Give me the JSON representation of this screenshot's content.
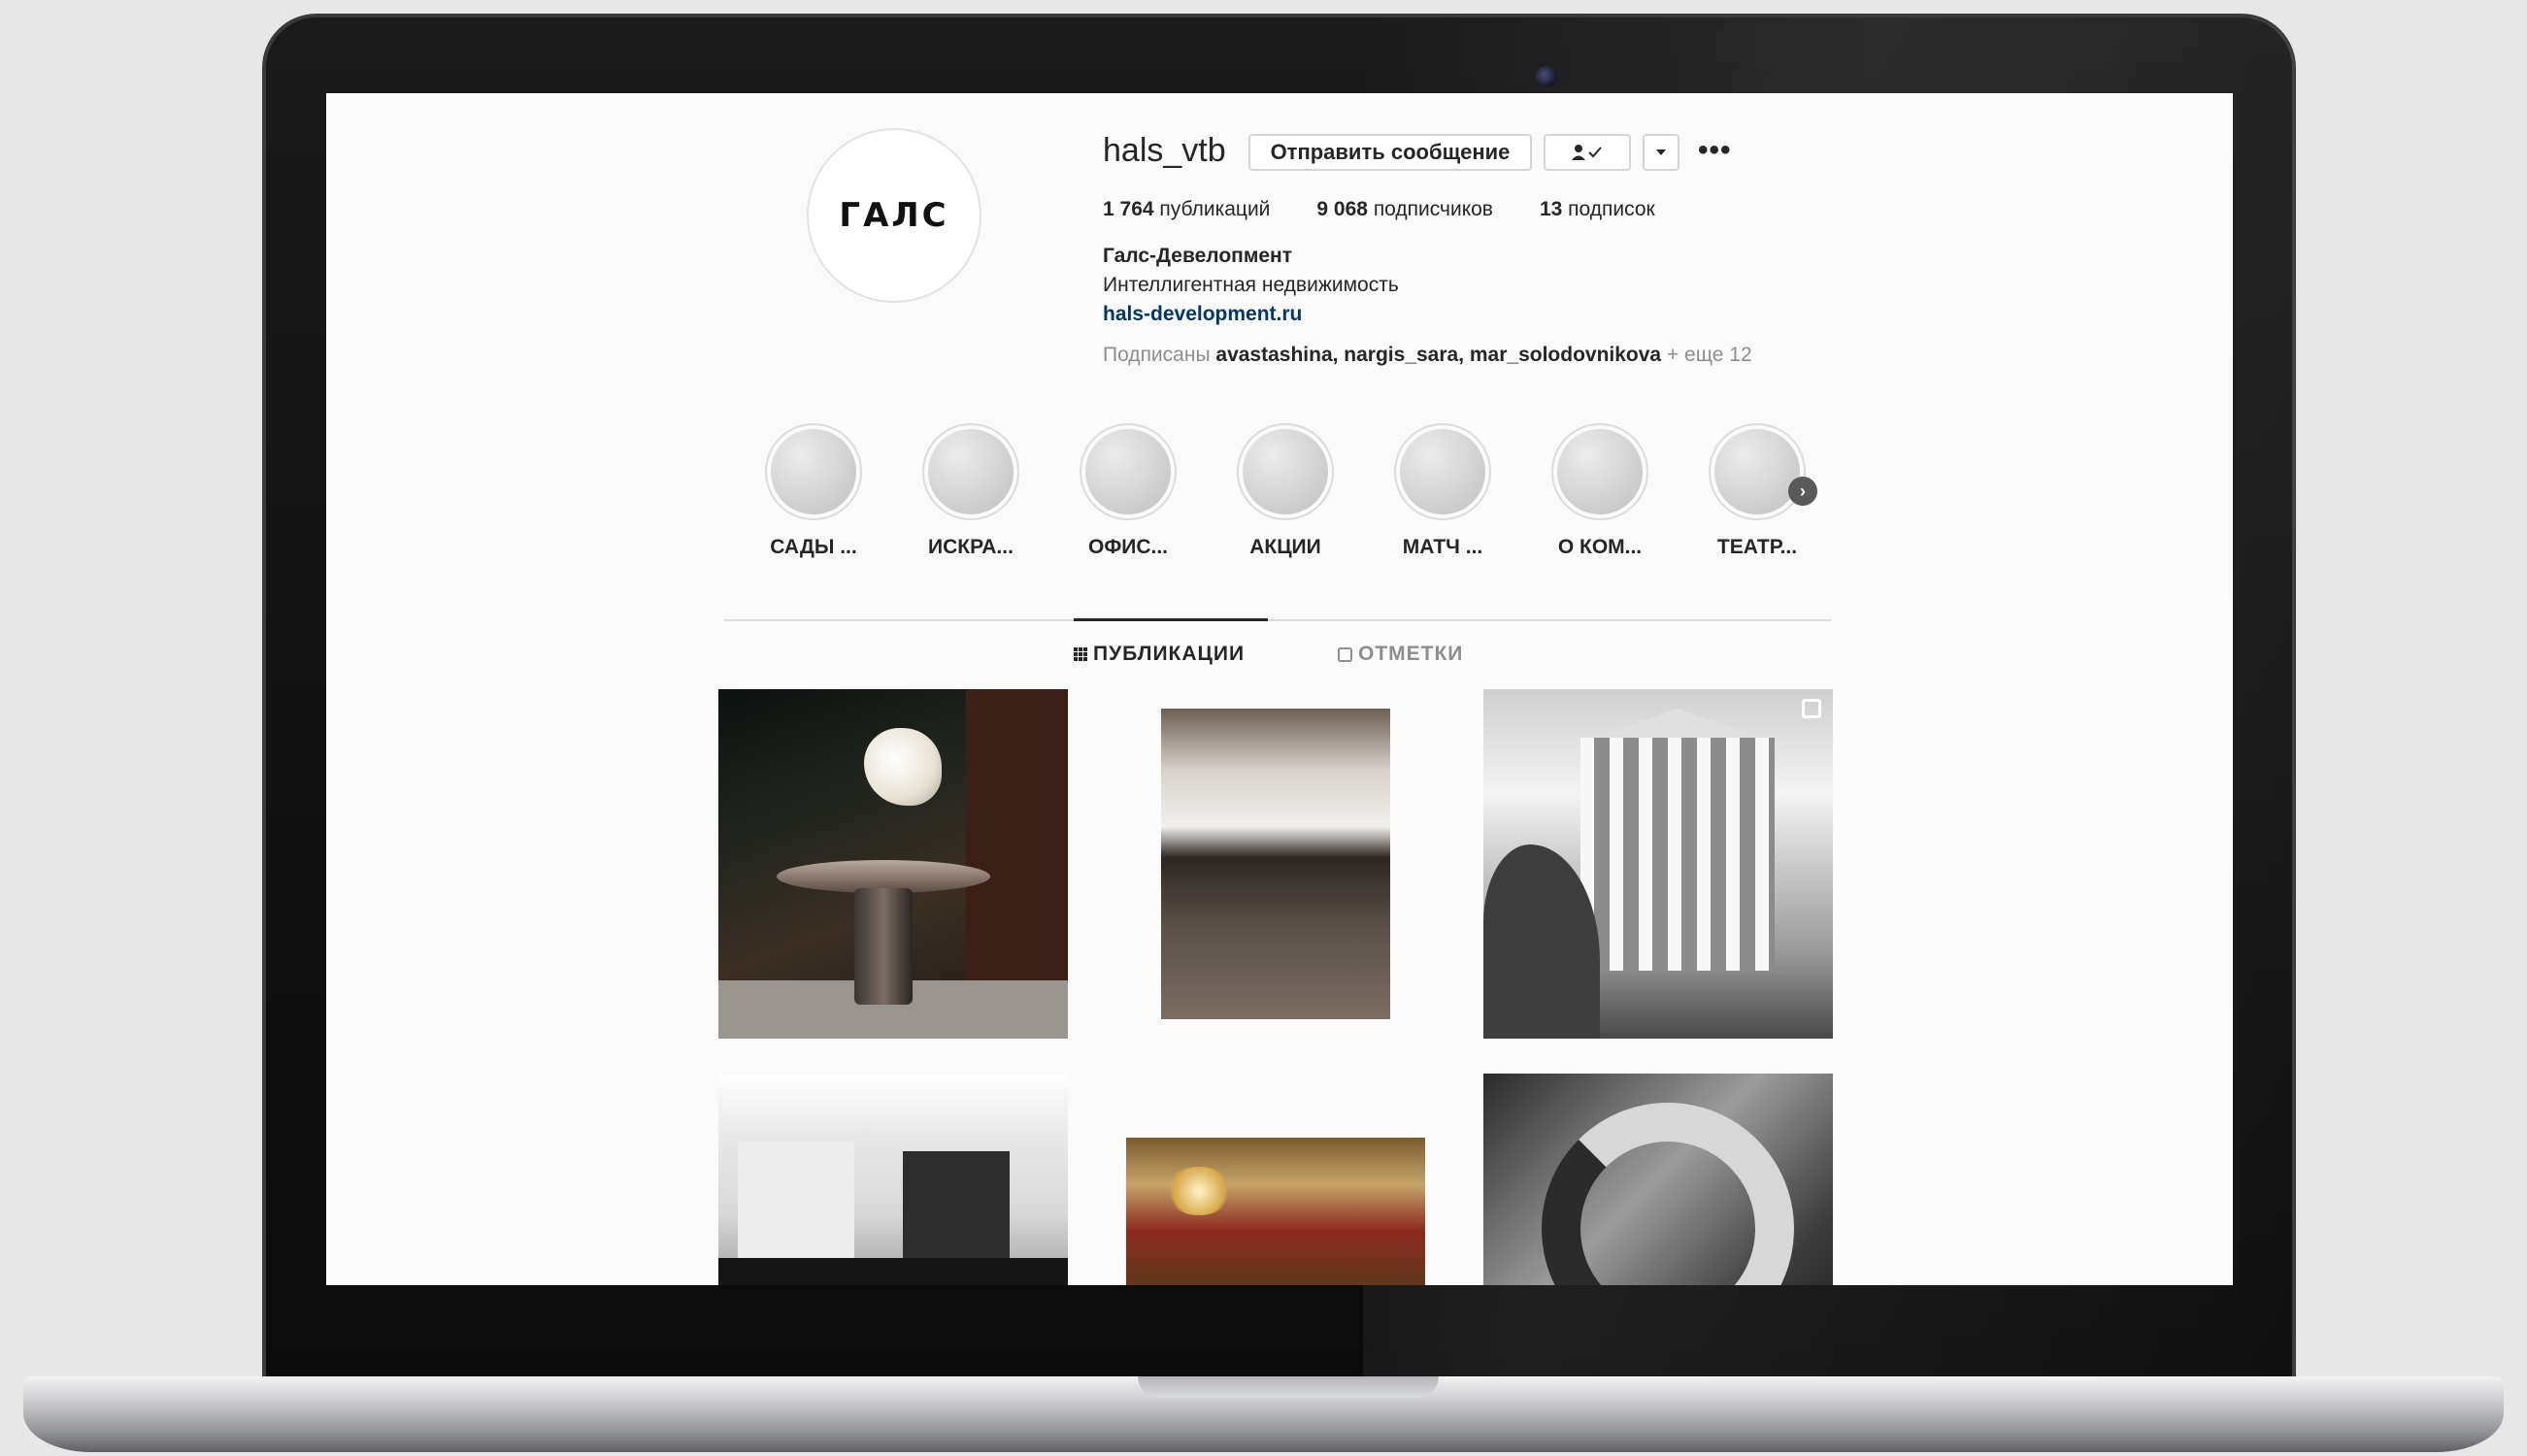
{
  "profile": {
    "avatar_logo": "ГАЛС",
    "username": "hals_vtb",
    "message_button": "Отправить сообщение",
    "follow_icon": "person-check-icon",
    "suggest_icon": "chevron-down-icon",
    "more_icon": "more-icon"
  },
  "stats": {
    "posts_count": "1 764",
    "posts_label": "публикаций",
    "followers_count": "9 068",
    "followers_label": "подписчиков",
    "following_count": "13",
    "following_label": "подписок"
  },
  "bio": {
    "name": "Галс-Девелопмент",
    "description": "Интеллигентная недвижимость",
    "link": "hals-development.ru",
    "followed_by_prefix": "Подписаны",
    "followed_by_users": "avastashina, nargis_sara, mar_solodovnikova",
    "followed_by_more": "+ еще 12"
  },
  "highlights": [
    {
      "label": "САДЫ ..."
    },
    {
      "label": "ИСКРА..."
    },
    {
      "label": "ОФИС..."
    },
    {
      "label": "АКЦИИ"
    },
    {
      "label": "МАТЧ ..."
    },
    {
      "label": "О КОМ..."
    },
    {
      "label": "ТЕАТР..."
    }
  ],
  "tabs": {
    "posts": "ПУБЛИКАЦИИ",
    "tagged": "ОТМЕТКИ"
  },
  "colors": {
    "brand_red": "#d8232a",
    "link_blue": "#00376b",
    "text": "#262626",
    "muted": "#8e8e8e"
  }
}
